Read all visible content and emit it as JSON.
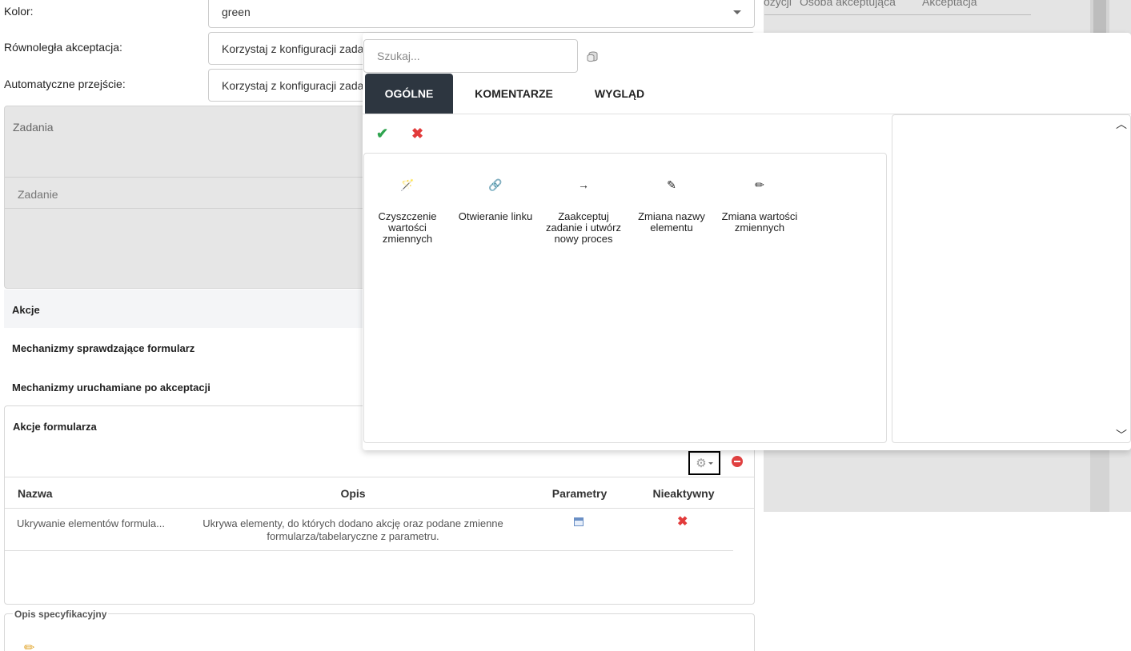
{
  "background": {
    "columns": [
      "ozycji",
      "Osoba akceptująca",
      "Akceptacja"
    ]
  },
  "form": {
    "kolor": {
      "label": "Kolor:",
      "value": "green"
    },
    "rownolegla": {
      "label": "Równoległa akceptacja:",
      "value": "Korzystaj z konfiguracji zadan"
    },
    "automatyczne": {
      "label": "Automatyczne przejście:",
      "value": "Korzystaj z konfiguracji zadan"
    }
  },
  "zadania": {
    "title": "Zadania",
    "subtitle": "Zadanie"
  },
  "sections": {
    "akcje": "Akcje",
    "mechanizmy_sprawdzajace": "Mechanizmy sprawdzające formularz",
    "mechanizmy_po_akceptacji": "Mechanizmy uruchamiane po akceptacji"
  },
  "akcje_formularza": {
    "title": "Akcje formularza",
    "headers": [
      "Nazwa",
      "Opis",
      "Parametry",
      "Nieaktywny"
    ],
    "rows": [
      {
        "name": "Ukrywanie elementów formula...",
        "description": "Ukrywa elementy, do których dodano akcję oraz podane zmienne formularza/tabelaryczne z parametru.",
        "inactive_icon": "x-icon"
      }
    ]
  },
  "spec": {
    "legend": "Opis specyfikacyjny"
  },
  "popup": {
    "search_placeholder": "Szukaj...",
    "tabs": [
      "OGÓLNE",
      "KOMENTARZE",
      "WYGLĄD"
    ],
    "active_tab": 0,
    "actions": [
      {
        "icon": "magic-wand-icon",
        "glyph": "🪄",
        "label": "Czyszczenie wartości zmiennych"
      },
      {
        "icon": "link-icon",
        "glyph": "🔗",
        "label": "Otwieranie linku"
      },
      {
        "icon": "arrow-right-icon",
        "glyph": "→",
        "label": "Zaakceptuj zadanie i utwórz nowy proces"
      },
      {
        "icon": "edit-square-icon",
        "glyph": "✎",
        "label": "Zmiana nazwy elementu"
      },
      {
        "icon": "pencil-icon",
        "glyph": "✏",
        "label": "Zmiana wartości zmiennych"
      }
    ]
  },
  "colors": {
    "tab_active_bg": "#2d3640",
    "confirm": "#2fa44f",
    "danger": "#e23b3b"
  }
}
